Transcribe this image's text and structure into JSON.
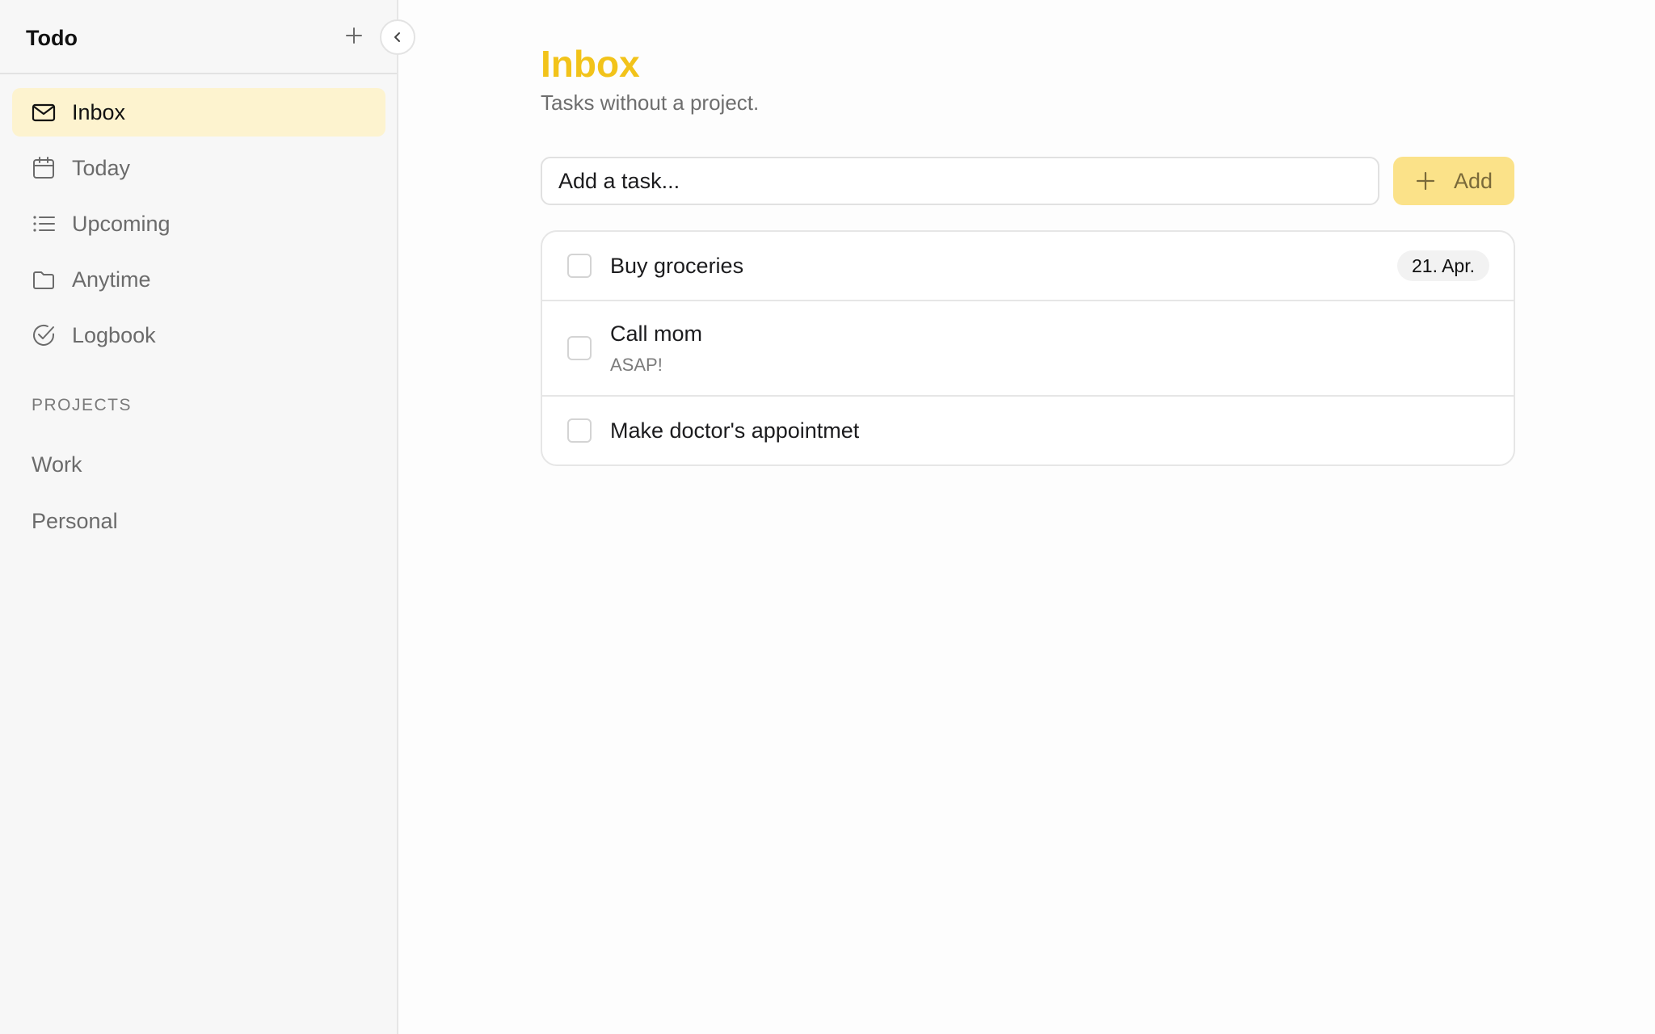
{
  "sidebar": {
    "app_title": "Todo",
    "nav": [
      {
        "label": "Inbox",
        "icon": "mail-icon",
        "active": true
      },
      {
        "label": "Today",
        "icon": "calendar-icon",
        "active": false
      },
      {
        "label": "Upcoming",
        "icon": "list-icon",
        "active": false
      },
      {
        "label": "Anytime",
        "icon": "folder-icon",
        "active": false
      },
      {
        "label": "Logbook",
        "icon": "check-circle-icon",
        "active": false
      }
    ],
    "projects_heading": "PROJECTS",
    "projects": [
      {
        "label": "Work"
      },
      {
        "label": "Personal"
      }
    ]
  },
  "main": {
    "title": "Inbox",
    "subtitle": "Tasks without a project.",
    "task_input_placeholder": "Add a task...",
    "add_button_label": "Add",
    "tasks": [
      {
        "title": "Buy groceries",
        "note": "",
        "date": "21. Apr."
      },
      {
        "title": "Call mom",
        "note": "ASAP!",
        "date": ""
      },
      {
        "title": "Make doctor's appointmet",
        "note": "",
        "date": ""
      }
    ]
  },
  "colors": {
    "accent": "#f2c31a",
    "active_nav_bg": "#fdf3cf",
    "add_button_bg": "#fbe289"
  }
}
